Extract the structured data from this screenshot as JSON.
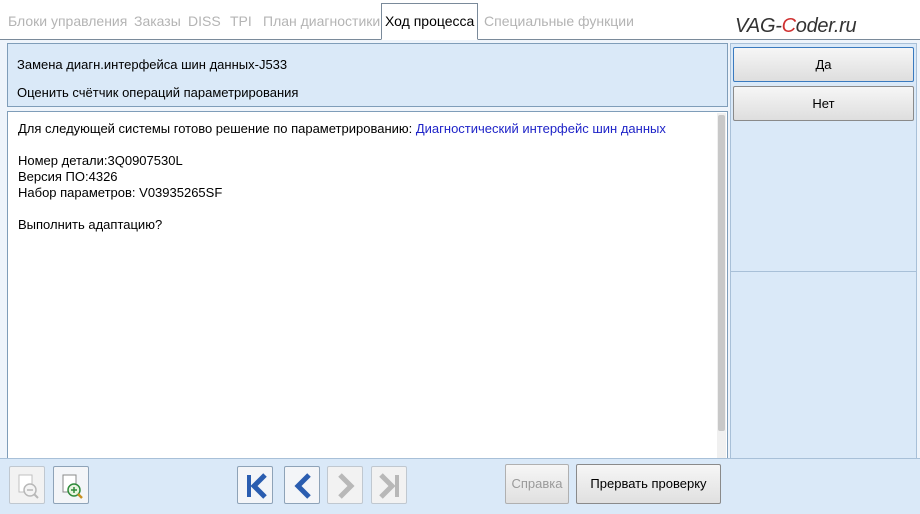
{
  "tabs": [
    {
      "label": "Блоки управления",
      "active": false
    },
    {
      "label": "Заказы",
      "active": false
    },
    {
      "label": "DISS",
      "active": false
    },
    {
      "label": "TPI",
      "active": false
    },
    {
      "label": "План диагностики",
      "active": false
    },
    {
      "label": "Ход процесса",
      "active": true
    },
    {
      "label": "Специальные функции",
      "active": false
    }
  ],
  "logo": {
    "pre": "VAG-",
    "mid": "C",
    "post": "oder.ru"
  },
  "header": {
    "title": "Замена диагн.интерфейса шин данных-J533",
    "subtitle": "Оценить счётчик операций параметрирования"
  },
  "content": {
    "intro": "Для следующей системы готово решение по параметрированию: ",
    "intro_link": "Диагностический интерфейс шин данных",
    "part_number": "Номер детали:3Q0907530L",
    "software_version": "Версия ПО:4326",
    "parameter_set": "Набор параметров: V03935265SF",
    "question": "Выполнить адаптацию?"
  },
  "right_panel": {
    "yes_label": "Да",
    "no_label": "Нет"
  },
  "toolbar": {
    "help_label": "Справка",
    "abort_label": "Прервать проверку",
    "icons": [
      "zoom-out-icon",
      "zoom-in-icon",
      "first-icon",
      "previous-icon",
      "next-icon",
      "last-icon"
    ]
  },
  "colors": {
    "panel_bg": "#dae9f8",
    "frame_bg": "#eef4fb",
    "border": "#7f9db9",
    "link": "#1f24c8",
    "nav_icon": "#2a5db0",
    "nav_icon_disabled": "#b8b8b8",
    "logo_accent": "#d03030"
  }
}
